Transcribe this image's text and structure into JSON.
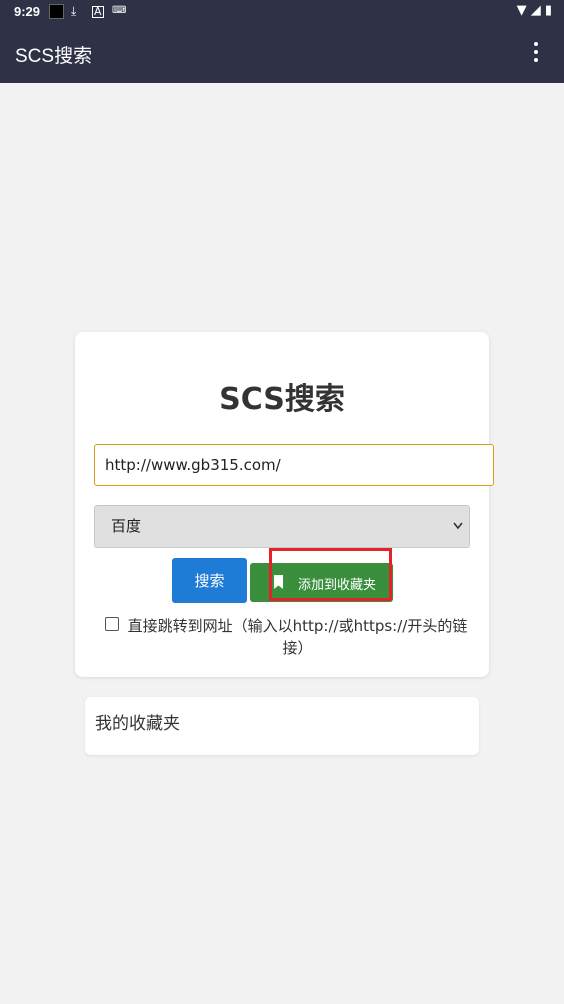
{
  "status_bar": {
    "time": "9:29",
    "icons": [
      "black-square-icon",
      "download-icon",
      "a-icon",
      "keyboard-icon"
    ],
    "right_icons": [
      "wifi-icon",
      "signal-icon",
      "battery-icon"
    ]
  },
  "app_bar": {
    "title": "SCS搜索",
    "menu_icon": "more-vert-icon"
  },
  "search_card": {
    "title": "SCS搜索",
    "url_value": "http://www.gb315.com/",
    "engine_selected": "百度",
    "search_label": "搜索",
    "add_favorite_label": "添加到收藏夹",
    "checkbox_label": "直接跳转到网址（输入以http://或https://开头的链接）",
    "checkbox_checked": false
  },
  "favorites": {
    "title": "我的收藏夹"
  },
  "colors": {
    "app_bar": "#2f3247",
    "search_button": "#1e7bd6",
    "favorite_button": "#3a8f3d",
    "highlight": "#e5222a",
    "input_border": "#d4a017"
  }
}
